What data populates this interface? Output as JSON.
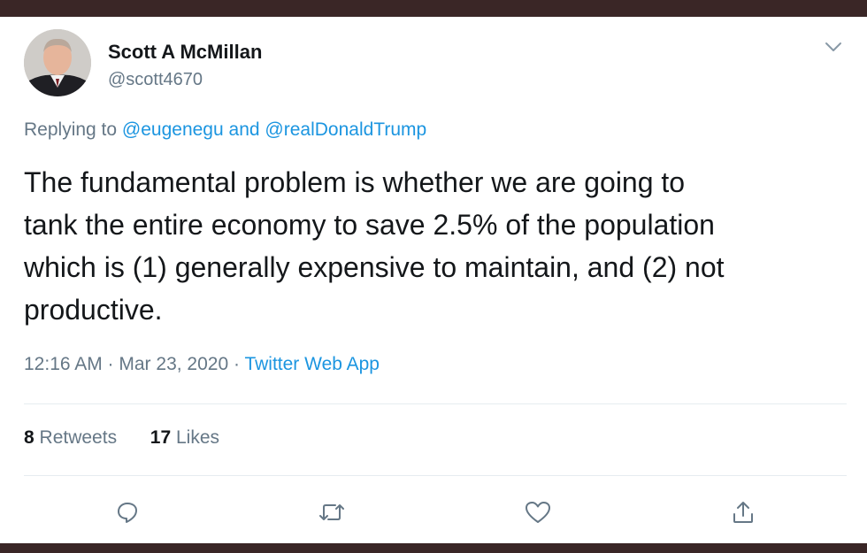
{
  "tweet": {
    "author_name": "Scott A McMillan",
    "author_handle": "@scott4670",
    "replying_prefix": "Replying to",
    "reply_handle_1": "@eugenegu",
    "reply_and": "and",
    "reply_handle_2": "@realDonaldTrump",
    "text": "The fundamental problem is whether we are going to\ntank the entire economy to save 2.5% of the population\nwhich is (1) generally expensive to maintain, and (2) not\nproductive.",
    "timestamp": "12:16 AM · Mar 23, 2020",
    "separator": "·",
    "source_app": "Twitter Web App",
    "retweets_count": "8",
    "retweets_label": "Retweets",
    "likes_count": "17",
    "likes_label": "Likes"
  },
  "icons": {
    "menu": "chevron-down-icon",
    "reply": "reply-icon",
    "retweet": "retweet-icon",
    "like": "heart-icon",
    "share": "share-icon"
  },
  "colors": {
    "link": "#1b95e0",
    "secondary_text": "#657786",
    "primary_text": "#14171a",
    "frame": "#3a2626"
  }
}
